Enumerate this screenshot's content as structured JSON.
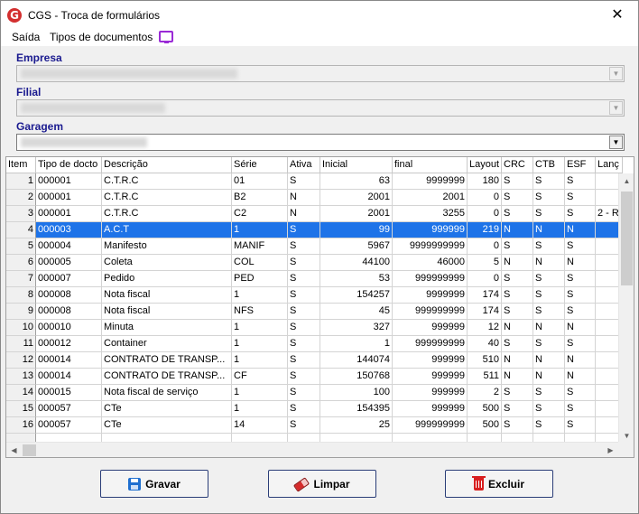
{
  "window": {
    "title": "CGS - Troca de formulários",
    "app_icon": "G",
    "close_glyph": "✕"
  },
  "menu": {
    "items": [
      "Saída",
      "Tipos de documentos"
    ],
    "monitor_icon": "monitor-icon"
  },
  "filters": {
    "empresa_label": "Empresa",
    "filial_label": "Filial",
    "garagem_label": "Garagem"
  },
  "grid": {
    "columns": [
      "Item",
      "Tipo de docto",
      "Descrição",
      "Série",
      "Ativa",
      "Inicial",
      "final",
      "Layout",
      "CRC",
      "CTB",
      "ESF",
      "Lanç"
    ],
    "rows": [
      [
        "1",
        "000001",
        "C.T.R.C",
        "01",
        "S",
        "63",
        "9999999",
        "180",
        "S",
        "S",
        "S",
        ""
      ],
      [
        "2",
        "000001",
        "C.T.R.C",
        "B2",
        "N",
        "2001",
        "2001",
        "0",
        "S",
        "S",
        "S",
        ""
      ],
      [
        "3",
        "000001",
        "C.T.R.C",
        "C2",
        "N",
        "2001",
        "3255",
        "0",
        "S",
        "S",
        "S",
        "2 - R"
      ],
      [
        "4",
        "000003",
        "A.C.T",
        "1",
        "S",
        "99",
        "999999",
        "219",
        "N",
        "N",
        "N",
        ""
      ],
      [
        "5",
        "000004",
        "Manifesto",
        "MANIF",
        "S",
        "5967",
        "9999999999",
        "0",
        "S",
        "S",
        "S",
        ""
      ],
      [
        "6",
        "000005",
        "Coleta",
        "COL",
        "S",
        "44100",
        "46000",
        "5",
        "N",
        "N",
        "N",
        ""
      ],
      [
        "7",
        "000007",
        "Pedido",
        "PED",
        "S",
        "53",
        "999999999",
        "0",
        "S",
        "S",
        "S",
        ""
      ],
      [
        "8",
        "000008",
        "Nota fiscal",
        "1",
        "S",
        "154257",
        "9999999",
        "174",
        "S",
        "S",
        "S",
        ""
      ],
      [
        "9",
        "000008",
        "Nota fiscal",
        "NFS",
        "S",
        "45",
        "999999999",
        "174",
        "S",
        "S",
        "S",
        ""
      ],
      [
        "10",
        "000010",
        "Minuta",
        "1",
        "S",
        "327",
        "999999",
        "12",
        "N",
        "N",
        "N",
        ""
      ],
      [
        "11",
        "000012",
        "Container",
        "1",
        "S",
        "1",
        "999999999",
        "40",
        "S",
        "S",
        "S",
        ""
      ],
      [
        "12",
        "000014",
        "CONTRATO DE TRANSP...",
        "1",
        "S",
        "144074",
        "999999",
        "510",
        "N",
        "N",
        "N",
        ""
      ],
      [
        "13",
        "000014",
        "CONTRATO DE TRANSP...",
        "CF",
        "S",
        "150768",
        "999999",
        "511",
        "N",
        "N",
        "N",
        ""
      ],
      [
        "14",
        "000015",
        "Nota fiscal de serviço",
        "1",
        "S",
        "100",
        "999999",
        "2",
        "S",
        "S",
        "S",
        ""
      ],
      [
        "15",
        "000057",
        "CTe",
        "1",
        "S",
        "154395",
        "999999",
        "500",
        "S",
        "S",
        "S",
        ""
      ],
      [
        "16",
        "000057",
        "CTe",
        "14",
        "S",
        "25",
        "999999999",
        "500",
        "S",
        "S",
        "S",
        ""
      ]
    ],
    "selected_row": 4
  },
  "buttons": {
    "save": "Gravar",
    "clear": "Limpar",
    "delete": "Excluir"
  },
  "colors": {
    "selection": "#1e73e8",
    "label": "#1a1a8f",
    "accent_purple": "#9a2bd6"
  }
}
